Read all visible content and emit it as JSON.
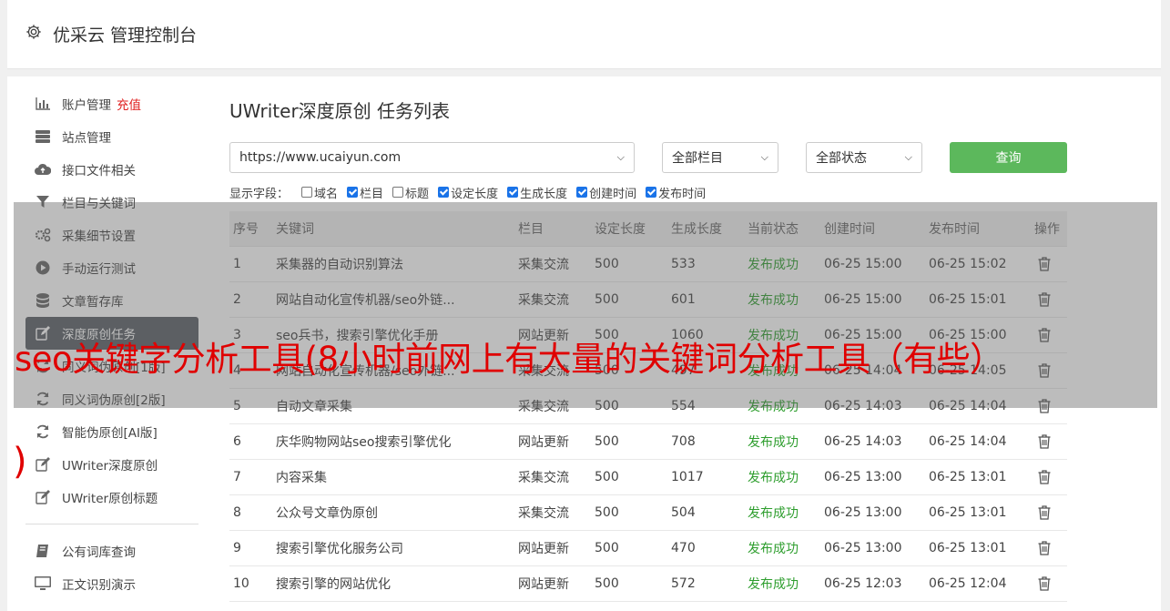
{
  "header": {
    "title": "优采云 管理控制台"
  },
  "sidebar": {
    "items": [
      {
        "icon": "bar-chart-icon",
        "label": "账户管理",
        "accent": "充值"
      },
      {
        "icon": "server-icon",
        "label": "站点管理"
      },
      {
        "icon": "cloud-upload-icon",
        "label": "接口文件相关"
      },
      {
        "icon": "filter-icon",
        "label": "栏目与关键词"
      },
      {
        "icon": "gears-icon",
        "label": "采集细节设置"
      },
      {
        "icon": "play-circle-icon",
        "label": "手动运行测试"
      },
      {
        "icon": "database-icon",
        "label": "文章暂存库"
      },
      {
        "icon": "edit-icon",
        "label": "深度原创任务"
      },
      {
        "icon": "refresh-icon",
        "label": "同义词伪原创[1版]"
      },
      {
        "icon": "refresh-icon",
        "label": "同义词伪原创[2版]"
      },
      {
        "icon": "refresh-icon",
        "label": "智能伪原创[AI版]"
      },
      {
        "icon": "edit-icon",
        "label": "UWriter深度原创"
      },
      {
        "icon": "edit-icon",
        "label": "UWriter原创标题"
      }
    ],
    "items2": [
      {
        "icon": "book-icon",
        "label": "公有词库查询"
      },
      {
        "icon": "monitor-icon",
        "label": "正文识别演示"
      }
    ]
  },
  "main": {
    "title": "UWriter深度原创 任务列表",
    "site_select": "https://www.ucaiyun.com",
    "column_select": "全部栏目",
    "status_select": "全部状态",
    "query_button": "查询",
    "fields_label": "显示字段：",
    "fields": [
      {
        "label": "域名",
        "checked": false
      },
      {
        "label": "栏目",
        "checked": true
      },
      {
        "label": "标题",
        "checked": false
      },
      {
        "label": "设定长度",
        "checked": true
      },
      {
        "label": "生成长度",
        "checked": true
      },
      {
        "label": "创建时间",
        "checked": true
      },
      {
        "label": "发布时间",
        "checked": true
      }
    ],
    "table": {
      "headers": [
        "序号",
        "关键词",
        "栏目",
        "设定长度",
        "生成长度",
        "当前状态",
        "创建时间",
        "发布时间",
        "操作"
      ],
      "rows": [
        [
          "1",
          "采集器的自动识别算法",
          "采集交流",
          "500",
          "533",
          "发布成功",
          "06-25 15:00",
          "06-25 15:02"
        ],
        [
          "2",
          "网站自动化宣传机器/seo外链...",
          "采集交流",
          "500",
          "601",
          "发布成功",
          "06-25 15:00",
          "06-25 15:01"
        ],
        [
          "3",
          "seo兵书，搜索引擎优化手册",
          "网站更新",
          "500",
          "1060",
          "发布成功",
          "06-25 15:00",
          "06-25 15:00"
        ],
        [
          "4",
          "网站自动化宣传机器/seo外链...",
          "采集交流",
          "500",
          "497",
          "发布成功",
          "06-25 14:04",
          "06-25 14:05"
        ],
        [
          "5",
          "自动文章采集",
          "采集交流",
          "500",
          "554",
          "发布成功",
          "06-25 14:03",
          "06-25 14:04"
        ],
        [
          "6",
          "庆华购物网站seo搜索引擎优化",
          "网站更新",
          "500",
          "708",
          "发布成功",
          "06-25 14:03",
          "06-25 14:04"
        ],
        [
          "7",
          "内容采集",
          "采集交流",
          "500",
          "1017",
          "发布成功",
          "06-25 13:00",
          "06-25 13:01"
        ],
        [
          "8",
          "公众号文章伪原创",
          "采集交流",
          "500",
          "504",
          "发布成功",
          "06-25 13:00",
          "06-25 13:01"
        ],
        [
          "9",
          "搜索引擎优化服务公司",
          "网站更新",
          "500",
          "470",
          "发布成功",
          "06-25 13:00",
          "06-25 13:01"
        ],
        [
          "10",
          "搜索引擎的网站优化",
          "网站更新",
          "500",
          "572",
          "发布成功",
          "06-25 12:03",
          "06-25 12:04"
        ]
      ]
    }
  },
  "banner": {
    "text": "seo关键字分析工具(8小时前网上有大量的关键词分析工具（有些）",
    "tail": ")"
  }
}
